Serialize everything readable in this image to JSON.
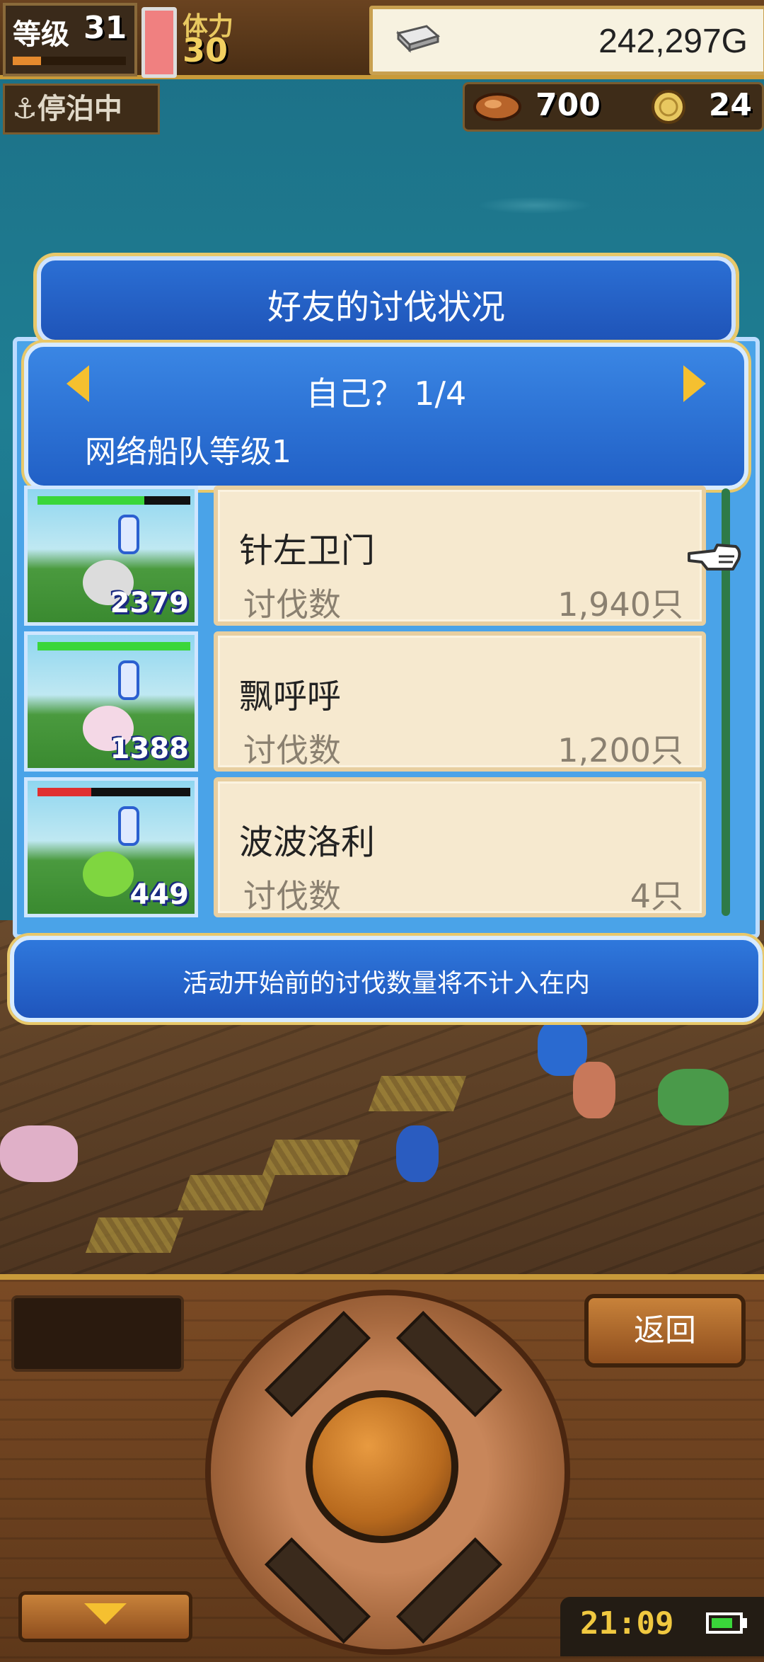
{
  "hud": {
    "level_label": "等级",
    "level": "31",
    "level_progress": 0.25,
    "stamina_label": "体力",
    "stamina": "30",
    "gold": "242,297G",
    "status": "⚓停泊中",
    "food": "700",
    "coins": "24"
  },
  "dialog": {
    "title": "好友的讨伐状况",
    "page_name": "自己？ 1/4",
    "subtitle": "网络船队等级1",
    "rows": [
      {
        "name": "针左卫门",
        "label": "讨伐数",
        "value": "1,940只",
        "thumb_count": "2379",
        "hp": 0.7,
        "monster_color": "#dcdcdc"
      },
      {
        "name": "飘呼呼",
        "label": "讨伐数",
        "value": "1,200只",
        "thumb_count": "1388",
        "hp": 1.0,
        "monster_color": "#f4d8e6"
      },
      {
        "name": "波波洛利",
        "label": "讨伐数",
        "value": "4只",
        "thumb_count": "449",
        "hp": 0.35,
        "monster_color": "#7fd640"
      }
    ],
    "note": "活动开始前的讨伐数量将不计入在内"
  },
  "controls": {
    "back_label": "返回",
    "clock": "21:09",
    "battery_level": 0.8
  },
  "colors": {
    "accent_gold": "#e8c86a",
    "dialog_blue": "#2b6fd4",
    "card_bg": "#f6e9cf"
  }
}
